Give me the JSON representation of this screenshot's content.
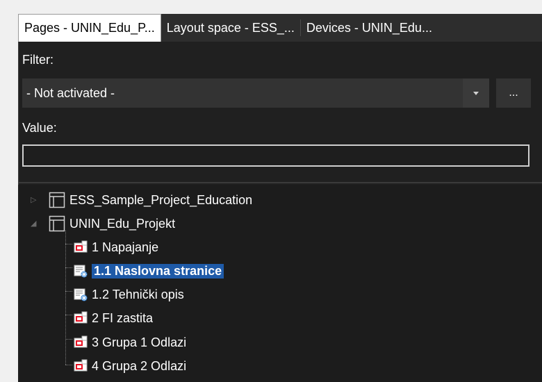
{
  "tabs": [
    {
      "label": "Pages - UNIN_Edu_P...",
      "active": true
    },
    {
      "label": "Layout space - ESS_...",
      "active": false
    },
    {
      "label": "Devices - UNIN_Edu...",
      "active": false
    }
  ],
  "filter": {
    "label": "Filter:",
    "selected": "- Not activated -",
    "more_label": "..."
  },
  "value": {
    "label": "Value:",
    "text": ""
  },
  "tree": {
    "projects": [
      {
        "label": "ESS_Sample_Project_Education",
        "expanded": false
      },
      {
        "label": "UNIN_Edu_Projekt",
        "expanded": true
      }
    ],
    "pages": [
      {
        "label": "1 Napajanje",
        "icon": "schematic-page-icon",
        "selected": false
      },
      {
        "label": "1.1 Naslovna stranice",
        "icon": "title-page-icon",
        "selected": true
      },
      {
        "label": "1.2 Tehnički opis",
        "icon": "title-page-icon",
        "selected": false
      },
      {
        "label": "2 FI zastita",
        "icon": "schematic-page-icon",
        "selected": false
      },
      {
        "label": "3 Grupa 1 Odlazi",
        "icon": "schematic-page-icon",
        "selected": false
      },
      {
        "label": "4 Grupa 2 Odlazi",
        "icon": "schematic-page-icon",
        "selected": false
      }
    ]
  },
  "colors": {
    "panel_bg": "#202020",
    "selection": "#1e5aa8",
    "page_icon_red": "#e81123",
    "title_icon_blue": "#2a7fd4"
  }
}
